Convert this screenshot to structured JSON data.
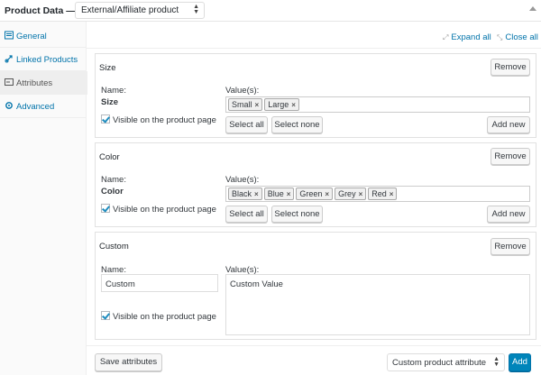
{
  "header": {
    "title": "Product Data —",
    "product_type": "External/Affiliate product"
  },
  "sidebar": {
    "items": [
      {
        "label": "General",
        "icon": "general-icon"
      },
      {
        "label": "Linked Products",
        "icon": "link-icon"
      },
      {
        "label": "Attributes",
        "icon": "attributes-icon"
      },
      {
        "label": "Advanced",
        "icon": "gear-icon"
      }
    ]
  },
  "toolbar": {
    "expand_all": "Expand all",
    "close_all": "Close all"
  },
  "labels": {
    "name": "Name:",
    "values": "Value(s):",
    "visible": "Visible on the product page",
    "remove": "Remove",
    "select_all": "Select all",
    "select_none": "Select none",
    "add_new": "Add new"
  },
  "attributes": [
    {
      "title": "Size",
      "name": "Size",
      "values": [
        "Small",
        "Large"
      ]
    },
    {
      "title": "Color",
      "name": "Color",
      "values": [
        "Black",
        "Blue",
        "Green",
        "Grey",
        "Red"
      ]
    },
    {
      "title": "Custom",
      "name": "Custom",
      "value": "Custom Value"
    }
  ],
  "footer": {
    "save": "Save attributes",
    "select": "Custom product attribute",
    "add": "Add"
  },
  "colors": {
    "link": "#0073aa",
    "primary": "#0085ba"
  }
}
